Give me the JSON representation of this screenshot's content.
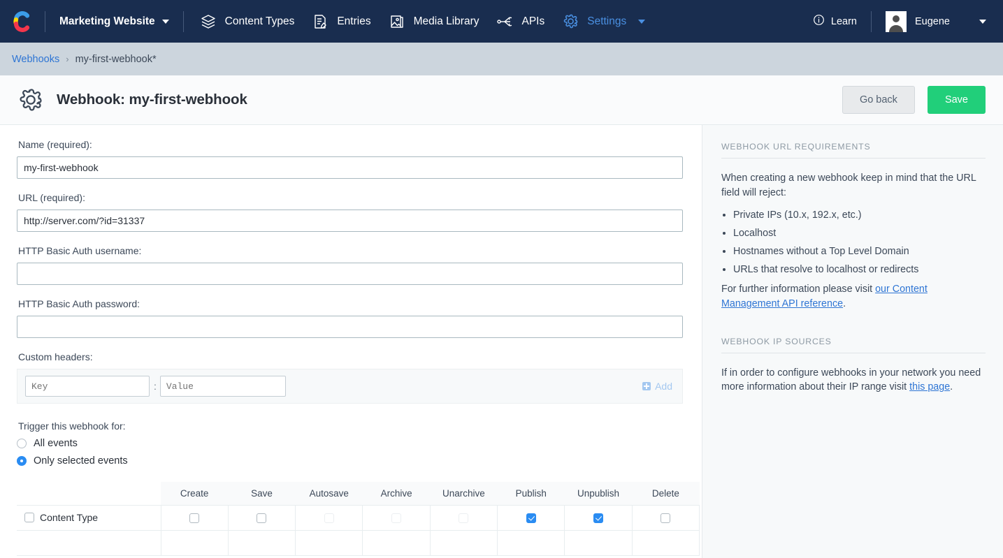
{
  "navbar": {
    "logo_icon": "contentful-logo-icon",
    "space_name": "Marketing Website",
    "items": [
      {
        "label": "Content Types",
        "icon": "layers-icon",
        "active": false
      },
      {
        "label": "Entries",
        "icon": "document-pen-icon",
        "active": false
      },
      {
        "label": "Media Library",
        "icon": "image-icon",
        "active": false
      },
      {
        "label": "APIs",
        "icon": "api-node-icon",
        "active": false
      },
      {
        "label": "Settings",
        "icon": "gear-icon",
        "active": true
      }
    ],
    "learn_label": "Learn",
    "learn_icon": "info-circle-icon",
    "user_name": "Eugene",
    "avatar_icon": "user-avatar"
  },
  "breadcrumb": {
    "root_label": "Webhooks",
    "separator": "›",
    "current_label": "my-first-webhook*"
  },
  "page_header": {
    "icon": "gear-icon",
    "title": "Webhook: my-first-webhook",
    "go_back_label": "Go back",
    "save_label": "Save"
  },
  "form": {
    "name": {
      "label": "Name (required):",
      "value": "my-first-webhook",
      "placeholder": ""
    },
    "url": {
      "label": "URL (required):",
      "value": "http://server.com/?id=31337",
      "placeholder": ""
    },
    "basic_auth_username": {
      "label": "HTTP Basic Auth username:",
      "value": "",
      "placeholder": ""
    },
    "basic_auth_password": {
      "label": "HTTP Basic Auth password:",
      "value": "",
      "placeholder": ""
    },
    "custom_headers": {
      "label": "Custom headers:",
      "key_placeholder": "Key",
      "key_value": "",
      "value_placeholder": "Value",
      "value_value": "",
      "colon": ":",
      "add_label": "Add"
    },
    "trigger": {
      "label": "Trigger this webhook for:",
      "options": [
        {
          "label": "All events",
          "selected": false
        },
        {
          "label": "Only selected events",
          "selected": true
        }
      ]
    }
  },
  "events_table": {
    "columns": [
      "Create",
      "Save",
      "Autosave",
      "Archive",
      "Unarchive",
      "Publish",
      "Unpublish",
      "Delete"
    ],
    "rows": [
      {
        "label": "Content Type",
        "row_checked": false,
        "cells": [
          {
            "state": "unchecked"
          },
          {
            "state": "unchecked"
          },
          {
            "state": "disabled"
          },
          {
            "state": "disabled"
          },
          {
            "state": "disabled"
          },
          {
            "state": "checked"
          },
          {
            "state": "checked"
          },
          {
            "state": "unchecked"
          }
        ]
      }
    ]
  },
  "sidebar": {
    "url_requirements": {
      "heading": "Webhook URL requirements",
      "intro": "When creating a new webhook keep in mind that the URL field will reject:",
      "bullets": [
        "Private IPs (10.x, 192.x, etc.)",
        "Localhost",
        "Hostnames without a Top Level Domain",
        "URLs that resolve to localhost or redirects"
      ],
      "footer_prefix": "For further information please visit ",
      "footer_link": "our Content Management API reference",
      "footer_suffix": "."
    },
    "ip_sources": {
      "heading": "Webhook IP sources",
      "text_prefix": "If in order to configure webhooks in your network you need more information about their IP range visit ",
      "link": "this page",
      "text_suffix": "."
    }
  },
  "colors": {
    "navbar_bg": "#192d4f",
    "accent_blue": "#2a8cf2",
    "link_blue": "#2e75d4",
    "save_green": "#21cf7a",
    "breadcrumb_bg": "#ccd5dd"
  }
}
